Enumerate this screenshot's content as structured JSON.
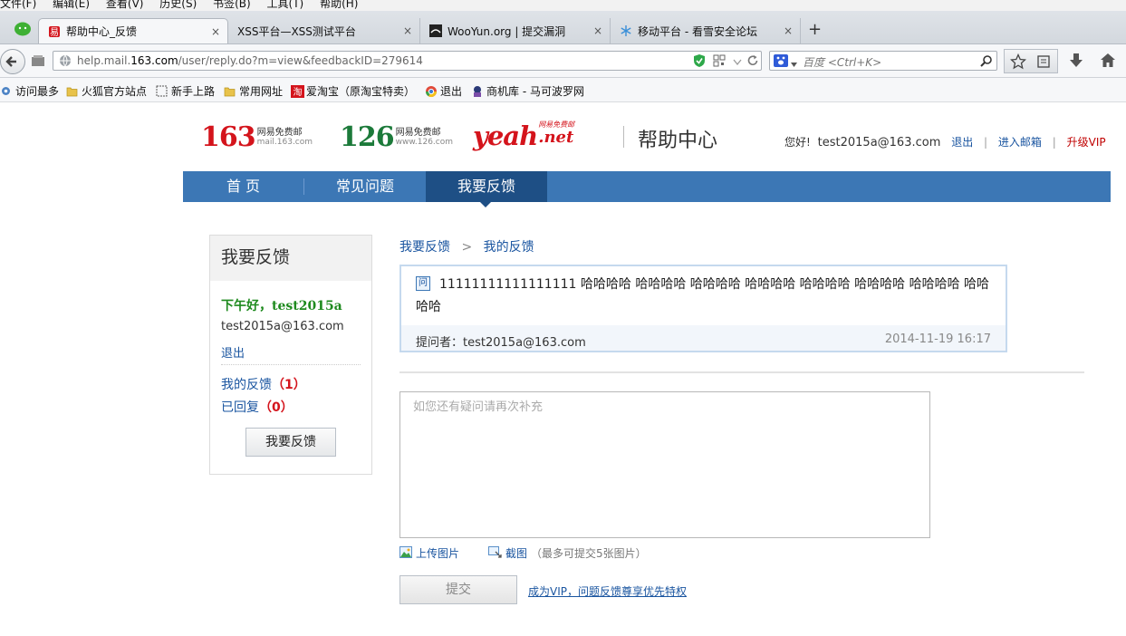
{
  "browser": {
    "menu": [
      "文件(F)",
      "编辑(E)",
      "查看(V)",
      "历史(S)",
      "书签(B)",
      "工具(T)",
      "帮助(H)"
    ],
    "tabs": [
      {
        "label": "帮助中心_反馈",
        "active": true
      },
      {
        "label": "XSS平台—XSS测试平台"
      },
      {
        "label": "WooYun.org | 提交漏洞"
      },
      {
        "label": "移动平台 - 看雪安全论坛"
      }
    ],
    "close_symbol": "×",
    "new_tab_symbol": "+",
    "url_plain_prefix": "help.mail.",
    "url_highlight": "163.com",
    "url_rest": "/user/reply.do?m=view&feedbackID=279614",
    "search_placeholder": "百度 <Ctrl+K>",
    "bookmarks": [
      "访问最多",
      "火狐官方站点",
      "新手上路",
      "常用网址",
      "爱淘宝（原淘宝特卖）",
      "退出",
      "商机库 - 马可波罗网"
    ]
  },
  "header": {
    "logo_163": {
      "num": "163",
      "line1": "网易免费邮",
      "line2": "mail.163.com"
    },
    "logo_126": {
      "num": "126",
      "line1": "网易免费邮",
      "line2": "www.126.com"
    },
    "logo_yeah": {
      "text": "yeah",
      "dot": ".net",
      "small": "网易免费邮"
    },
    "title": "帮助中心",
    "greeting": "您好!",
    "user_email": "test2015a@163.com",
    "logout": "退出",
    "sep": "|",
    "enter_mail": "进入邮箱",
    "upgrade_vip": "升级VIP"
  },
  "nav": {
    "items": [
      "首 页",
      "常见问题",
      "我要反馈"
    ],
    "active_index": 2
  },
  "sidebar": {
    "title": "我要反馈",
    "greeting": "下午好，test2015a",
    "email": "test2015a@163.com",
    "logout": "退出",
    "my_feedback": "我的反馈",
    "my_feedback_count": "（1）",
    "replied": "已回复",
    "replied_count": "（0）",
    "button": "我要反馈"
  },
  "breadcrumb": {
    "first": "我要反馈",
    "sep": ">",
    "second": "我的反馈"
  },
  "question": {
    "tag": "问",
    "content": "11111111111111111 哈哈哈哈 哈哈哈哈 哈哈哈哈 哈哈哈哈 哈哈哈哈 哈哈哈哈 哈哈哈哈 哈哈哈哈",
    "asker_label": "提问者：",
    "asker": "test2015a@163.com",
    "time": "2014-11-19 16:17"
  },
  "reply": {
    "placeholder": "如您还有疑问请再次补充",
    "upload_image": "上传图片",
    "screenshot": "截图",
    "limit_note": "（最多可提交5张图片）",
    "submit": "提交",
    "vip_link": "成为VIP，问题反馈尊享优先特权"
  },
  "colors": {
    "nav_blue": "#3c77b5",
    "nav_active": "#1e4f85",
    "link": "#1a55a0",
    "green_greet": "#1e8a1e",
    "red_vip": "#c00000",
    "logo_red": "#d4141c",
    "logo_green": "#1c7a3a"
  }
}
